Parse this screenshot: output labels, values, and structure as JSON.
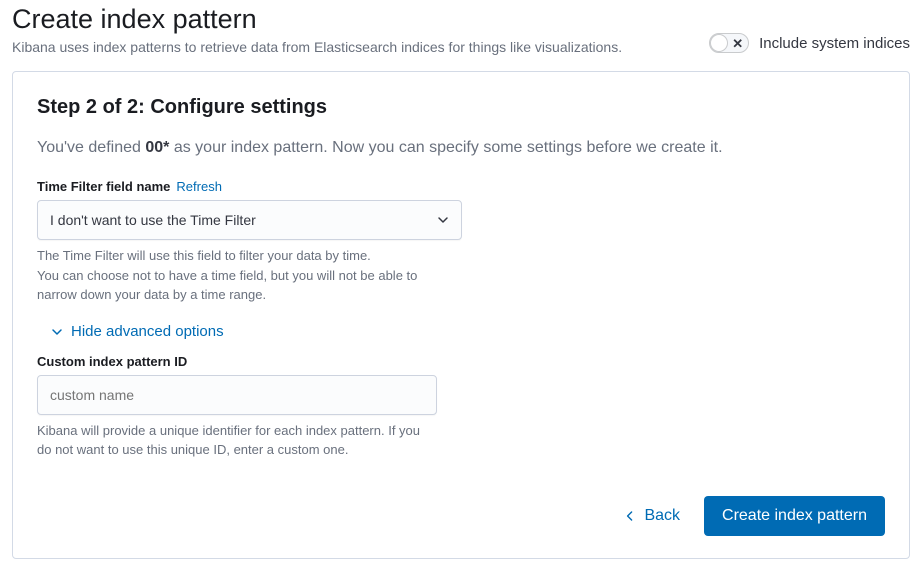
{
  "header": {
    "title": "Create index pattern",
    "subtitle": "Kibana uses index patterns to retrieve data from Elasticsearch indices for things like visualizations.",
    "toggle_label": "Include system indices",
    "toggle_on": false
  },
  "step": {
    "title": "Step 2 of 2: Configure settings",
    "desc_prefix": "You've defined ",
    "pattern_name": "00*",
    "desc_suffix": " as your index pattern. Now you can specify some settings before we create it."
  },
  "time_filter": {
    "label": "Time Filter field name",
    "refresh_label": "Refresh",
    "selected": "I don't want to use the Time Filter",
    "help": "The Time Filter will use this field to filter your data by time.\nYou can choose not to have a time field, but you will not be able to\nnarrow down your data by a time range."
  },
  "advanced": {
    "toggle_label": "Hide advanced options",
    "custom_id_label": "Custom index pattern ID",
    "custom_id_placeholder": "custom name",
    "custom_id_value": "",
    "custom_id_help": "Kibana will provide a unique identifier for each index pattern. If you do not want to use this unique ID, enter a custom one."
  },
  "footer": {
    "back_label": "Back",
    "create_label": "Create index pattern"
  }
}
